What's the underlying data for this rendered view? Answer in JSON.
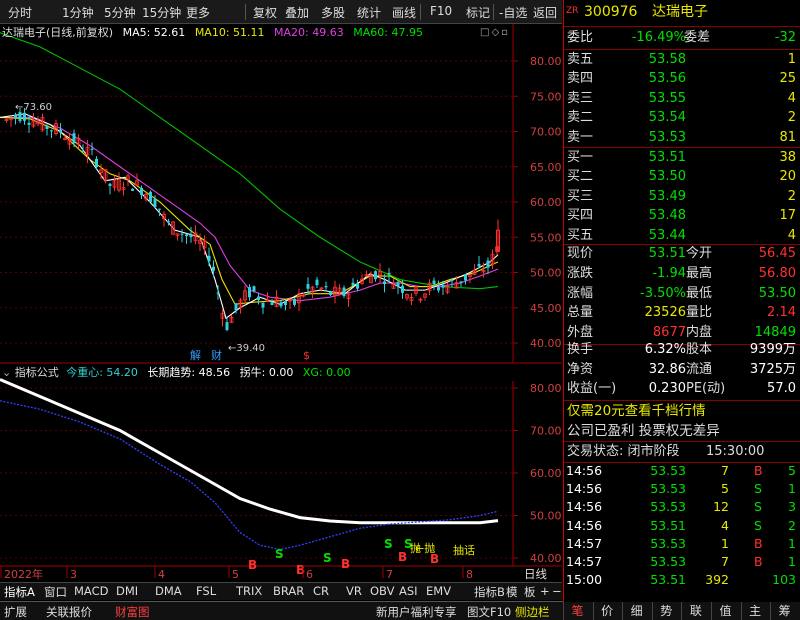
{
  "toolbar": {
    "items": [
      "分时",
      "1分钟",
      "5分钟",
      "15分钟",
      "更多",
      "复权",
      "叠加",
      "多股",
      "统计",
      "画线",
      "F10",
      "标记",
      "-自选",
      "返回"
    ]
  },
  "kline_header": {
    "title": "达瑞电子(日线,前复权)",
    "ma5": "MA5: 52.61",
    "ma10": "MA10: 51.11",
    "ma20": "MA20: 49.63",
    "ma60": "MA60: 47.95"
  },
  "kline": {
    "price_ticks": [
      "80.00",
      "75.00",
      "70.00",
      "65.00",
      "60.00",
      "55.00",
      "50.00",
      "45.00",
      "40.00"
    ],
    "high_mark": "73.60",
    "low_mark": "39.40",
    "signal_labels": [
      "解",
      "财",
      "$"
    ]
  },
  "ind_header": {
    "name": "指标公式",
    "today_focus": "今重心: 54.20",
    "long_trend": "长期趋势: 48.56",
    "turn": "拐牛: 0.00",
    "xg": "XG: 0.00"
  },
  "ind": {
    "ticks": [
      "80.00",
      "70.00",
      "60.00",
      "50.00",
      "40.00"
    ],
    "annotations": [
      {
        "text": "B",
        "color": "#ff3030"
      },
      {
        "text": "S",
        "color": "#00e000"
      },
      {
        "text": "B",
        "color": "#ff3030"
      },
      {
        "text": "S",
        "color": "#00e000"
      },
      {
        "text": "B",
        "color": "#ff3030"
      },
      {
        "text": "S",
        "color": "#00e000"
      },
      {
        "text": "S",
        "color": "#00e000"
      },
      {
        "text": "B",
        "color": "#ff3030"
      },
      {
        "text": "B",
        "color": "#ff3030"
      }
    ],
    "notes": [
      "抛",
      "←抛",
      "抽话"
    ]
  },
  "xaxis": {
    "labels": [
      "2022年",
      "3",
      "4",
      "5",
      "6",
      "7",
      "8"
    ],
    "period": "日线"
  },
  "ind_tabs": [
    "指标A",
    "窗口",
    "MACD",
    "DMI",
    "DMA",
    "FSL",
    "TRIX",
    "BRAR",
    "CR",
    "VR",
    "OBV",
    "ASI",
    "EMV",
    "",
    "指标B",
    "模",
    "板",
    "+",
    "−"
  ],
  "bottom_tabs": [
    "扩展",
    "关联报价",
    "财富图"
  ],
  "bottom_right": [
    "新用户福利专享",
    "图文F10",
    "侧边栏"
  ],
  "right_tabs": [
    "笔",
    "价",
    "细",
    "势",
    "联",
    "值",
    "主",
    "筹"
  ],
  "quote": {
    "code": "300976",
    "name": "达瑞电子",
    "weibi_label": "委比",
    "weibi": "-16.49%",
    "weicha_label": "委差",
    "weicha": "-32",
    "sells": [
      {
        "label": "卖五",
        "price": "53.58",
        "vol": "1"
      },
      {
        "label": "卖四",
        "price": "53.56",
        "vol": "25"
      },
      {
        "label": "卖三",
        "price": "53.55",
        "vol": "4"
      },
      {
        "label": "卖二",
        "price": "53.54",
        "vol": "2"
      },
      {
        "label": "卖一",
        "price": "53.53",
        "vol": "81"
      }
    ],
    "buys": [
      {
        "label": "买一",
        "price": "53.51",
        "vol": "38"
      },
      {
        "label": "买二",
        "price": "53.50",
        "vol": "20"
      },
      {
        "label": "买三",
        "price": "53.49",
        "vol": "2"
      },
      {
        "label": "买四",
        "price": "53.48",
        "vol": "17"
      },
      {
        "label": "买五",
        "price": "53.44",
        "vol": "4"
      }
    ],
    "stats": [
      {
        "l1": "现价",
        "v1": "53.51",
        "c1": "g",
        "l2": "今开",
        "v2": "56.45",
        "c2": "r"
      },
      {
        "l1": "涨跌",
        "v1": "-1.94",
        "c1": "g",
        "l2": "最高",
        "v2": "56.80",
        "c2": "r"
      },
      {
        "l1": "涨幅",
        "v1": "-3.50%",
        "c1": "g",
        "l2": "最低",
        "v2": "53.50",
        "c2": "g"
      },
      {
        "l1": "总量",
        "v1": "23526",
        "c1": "y",
        "l2": "量比",
        "v2": "2.14",
        "c2": "r"
      },
      {
        "l1": "外盘",
        "v1": "8677",
        "c1": "r",
        "l2": "内盘",
        "v2": "14849",
        "c2": "g"
      }
    ],
    "stats2": [
      {
        "l1": "换手",
        "v1": "6.32%",
        "l2": "股本",
        "v2": "9399万"
      },
      {
        "l1": "净资",
        "v1": "32.86",
        "l2": "流通",
        "v2": "3725万"
      },
      {
        "l1": "收益(一)",
        "v1": "0.230",
        "l2": "PE(动)",
        "v2": "57.0"
      }
    ],
    "promo": "仅需20元查看千档行情",
    "company_note": "公司已盈利 投票权无差异",
    "status_label": "交易状态: 闭市阶段",
    "status_time": "15:30:00",
    "ticks": [
      {
        "time": "14:56",
        "price": "53.53",
        "vol": "7",
        "bs": "B",
        "n": "5"
      },
      {
        "time": "14:56",
        "price": "53.53",
        "vol": "5",
        "bs": "S",
        "n": "1"
      },
      {
        "time": "14:56",
        "price": "53.53",
        "vol": "12",
        "bs": "S",
        "n": "3"
      },
      {
        "time": "14:56",
        "price": "53.51",
        "vol": "4",
        "bs": "S",
        "n": "2"
      },
      {
        "time": "14:57",
        "price": "53.53",
        "vol": "1",
        "bs": "B",
        "n": "1"
      },
      {
        "time": "14:57",
        "price": "53.53",
        "vol": "7",
        "bs": "B",
        "n": "1"
      },
      {
        "time": "15:00",
        "price": "53.51",
        "vol": "392",
        "bs": "",
        "n": "103"
      }
    ]
  }
}
